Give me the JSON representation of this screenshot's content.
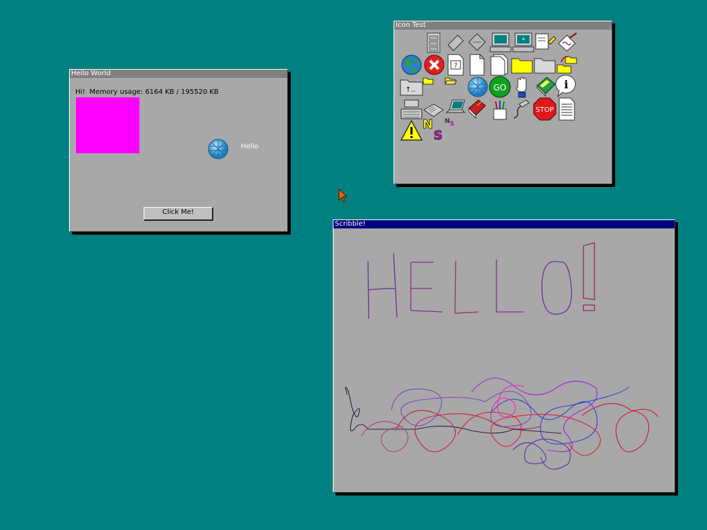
{
  "hello_window": {
    "title": "Hello World",
    "memory_text": "Hi!  Memory usage: 6164 KB / 195520 KB",
    "hello_label": "Hello",
    "button_label": "Click Me!",
    "swatch_color": "#ff00ff"
  },
  "icon_window": {
    "title": "Icon Test",
    "icon_names": [
      "file-cabinet-icon",
      "chip-icon",
      "chip-icon",
      "computer-icon",
      "computer-icon",
      "edit-document-icon",
      "edit-document-icon",
      "globe-icon",
      "error-icon",
      "help-file-icon",
      "document-icon",
      "documents-icon",
      "folder-icon",
      "folder-gray-icon",
      "folder-move-icon",
      "up-folder-icon",
      "small-folder-icon",
      "open-folder-icon",
      "globe-icon",
      "go-icon",
      "hand-icon",
      "book-icon",
      "info-icon",
      "keyboard-icon",
      "keyboard-icon",
      "laptop-icon",
      "book-icon",
      "pencil-cup-icon",
      "plug-icon",
      "stop-icon",
      "text-document-icon",
      "warning-icon",
      "north-icon",
      "south-icon",
      "north-south-icon"
    ],
    "go_text": "GO",
    "stop_text": "STOP",
    "info_text": "i",
    "north_text": "N",
    "south_text": "S",
    "ns_text": "N",
    "ns_sub": "S"
  },
  "scribble_window": {
    "title": "Scribble!"
  },
  "colors": {
    "desktop": "#008080",
    "window_face": "#a8a8a8",
    "active_title": "#000080",
    "inactive_title": "#808080"
  }
}
